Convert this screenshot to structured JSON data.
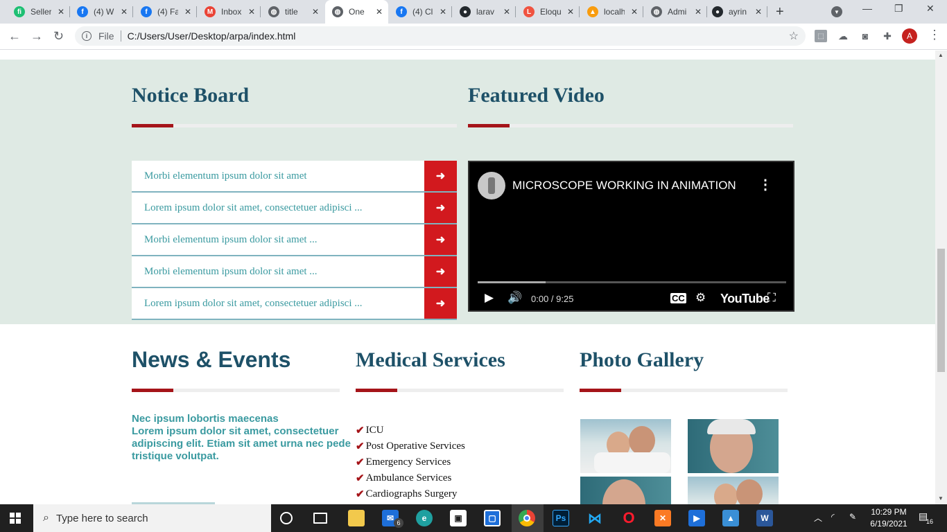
{
  "browser": {
    "tabs": [
      {
        "label": "Seller",
        "icon": "fiverr-icon",
        "color": "#1dbf73",
        "glyph": "fi"
      },
      {
        "label": "(4) W",
        "icon": "facebook-icon",
        "color": "#1877f2",
        "glyph": "f"
      },
      {
        "label": "(4) Fa",
        "icon": "facebook-icon",
        "color": "#1877f2",
        "glyph": "f"
      },
      {
        "label": "Inbox",
        "icon": "gmail-icon",
        "color": "#ea4335",
        "glyph": "M"
      },
      {
        "label": "title",
        "icon": "globe-icon",
        "color": "#5f6368",
        "glyph": "◍"
      },
      {
        "label": "One",
        "icon": "globe-icon",
        "color": "#5f6368",
        "glyph": "◍",
        "active": true
      },
      {
        "label": "(4) Cl",
        "icon": "facebook-icon",
        "color": "#1877f2",
        "glyph": "f"
      },
      {
        "label": "larav",
        "icon": "github-icon",
        "color": "#24292e",
        "glyph": "●"
      },
      {
        "label": "Eloqu",
        "icon": "laravel-icon",
        "color": "#f05340",
        "glyph": "L"
      },
      {
        "label": "localh",
        "icon": "phpmyadmin-icon",
        "color": "#f89c0e",
        "glyph": "▲"
      },
      {
        "label": "Admi",
        "icon": "globe-icon",
        "color": "#5f6368",
        "glyph": "◍"
      },
      {
        "label": "ayrin",
        "icon": "github-icon",
        "color": "#24292e",
        "glyph": "●"
      }
    ],
    "scheme": "File",
    "url": "C:/Users/User/Desktop/arpa/index.html",
    "profile_initial": "A"
  },
  "notice": {
    "title": "Notice Board",
    "items": [
      "Morbi elementum ipsum dolor sit amet",
      "Lorem ipsum dolor sit amet, consectetuer adipisci ...",
      "Morbi elementum ipsum dolor sit amet ...",
      "Morbi elementum ipsum dolor sit amet ...",
      "Lorem ipsum dolor sit amet, consectetuer adipisci ..."
    ]
  },
  "video": {
    "section_title": "Featured Video",
    "title": "MICROSCOPE WORKING IN ANIMATION",
    "time": "0:00 / 9:25",
    "brand": "YouTube",
    "buffered_fraction": 0.22
  },
  "news": {
    "title": "News & Events",
    "headline": "Nec ipsum lobortis maecenas",
    "body": "Lorem ipsum dolor sit amet, consectetuer adipiscing elit. Etiam sit amet urna nec pede tristique volutpat."
  },
  "services": {
    "title": "Medical Services",
    "items": [
      "ICU",
      "Post Operative Services",
      "Emergency Services",
      "Ambulance Services",
      "Cardiographs Surgery"
    ]
  },
  "gallery": {
    "title": "Photo Gallery"
  },
  "taskbar": {
    "search_placeholder": "Type here to search",
    "mail_badge": "6",
    "time": "10:29 PM",
    "date": "6/19/2021",
    "notification_count": "16"
  },
  "colors": {
    "heading": "#1e5168",
    "accent_red": "#a51419",
    "teal_text": "#3a9aa0",
    "section_bg": "#dfeae4"
  }
}
